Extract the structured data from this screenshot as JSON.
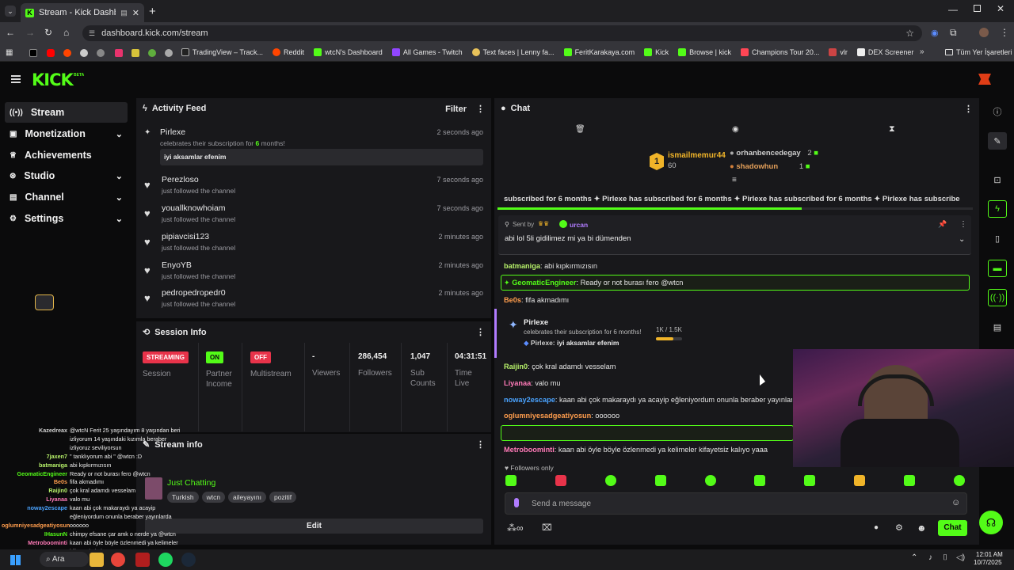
{
  "browser": {
    "tab_title": "Stream - Kick Dashboard",
    "url": "dashboard.kick.com/stream",
    "bookmarks": [
      "TradingView – Track...",
      "Reddit",
      "wtcN's Dashboard",
      "All Games - Twitch",
      "Text faces | Lenny fa...",
      "FeritKarakaya.com",
      "Kick",
      "Browse | kick",
      "Champions Tour 20...",
      "vlr",
      "DEX Screener"
    ],
    "all_bookmarks": "Tüm Yer İşaretleri"
  },
  "app": {
    "logo": "KICK",
    "beta": "BETA"
  },
  "sidebar": {
    "items": [
      {
        "label": "Stream"
      },
      {
        "label": "Monetization"
      },
      {
        "label": "Achievements"
      },
      {
        "label": "Studio"
      },
      {
        "label": "Channel"
      },
      {
        "label": "Settings"
      }
    ]
  },
  "activity": {
    "title": "Activity Feed",
    "filter": "Filter",
    "sub_event": {
      "name": "Pirlexe",
      "text_pre": "celebrates their subscription for ",
      "months": "6",
      "text_post": " months!",
      "time": "2 seconds ago",
      "message": "iyi aksamlar efenim"
    },
    "follows": [
      {
        "name": "Perezloso",
        "text": "just followed the channel",
        "time": "7 seconds ago"
      },
      {
        "name": "youallknowhoiam",
        "text": "just followed the channel",
        "time": "7 seconds ago"
      },
      {
        "name": "pipiavcisi123",
        "text": "just followed the channel",
        "time": "2 minutes ago"
      },
      {
        "name": "EnyoYB",
        "text": "just followed the channel",
        "time": "2 minutes ago"
      },
      {
        "name": "pedropedropedr0",
        "text": "just followed the channel",
        "time": "2 minutes ago"
      }
    ]
  },
  "session": {
    "title": "Session Info",
    "streaming": "STREAMING",
    "session_label": "Session",
    "partner_on": "ON",
    "partner_label": "Partner Income",
    "multistream_off": "OFF",
    "multistream_label": "Multistream",
    "viewers": "-",
    "viewers_label": "Viewers",
    "followers": "286,454",
    "followers_label": "Followers",
    "subs": "1,047",
    "subs_label": "Sub Counts",
    "time": "04:31:51",
    "time_label": "Time Live"
  },
  "stream_info": {
    "title": "Stream info",
    "category": "Just Chatting",
    "tags": [
      "Turkish",
      "wtcn",
      "aileyayını",
      "pozitif"
    ],
    "edit": "Edit"
  },
  "chat": {
    "title": "Chat",
    "leaderboard": [
      {
        "rank": "1",
        "name": "ismailmemur44",
        "count": "60"
      },
      {
        "name": "orhanbencedegay",
        "count": "2"
      },
      {
        "name": "shadowhun",
        "count": "1"
      }
    ],
    "ticker": "subscribed for 6 months  ✦ Pirlexe has subscribed for 6 months  ✦ Pirlexe has subscribed for 6 months  ✦ Pirlexe has subscribe",
    "pinned": {
      "sent_by": "Sent by",
      "user": "urcan",
      "text": "abi lol 5li gidilimez mi ya bi dümenden"
    },
    "messages": [
      {
        "user": "batmaniga",
        "text": "abi kıpkırmızısın",
        "color": "#b7f26a"
      },
      {
        "user": "GeomaticEngineer",
        "text": "Ready or not burası fero @wtcn",
        "color": "#53fc18"
      },
      {
        "user": "Be0s",
        "text": "fifa akmadımı",
        "color": "#ff9d4d"
      }
    ],
    "sub_card": {
      "name": "Pirlexe",
      "text": "celebrates their subscription for 6 months!",
      "progress": "1K / 1.5K",
      "msg_user": "Pirlexe:",
      "msg": "iyi aksamlar efenim"
    },
    "messages2": [
      {
        "user": "Raijin0",
        "text": "çok kral adamdı vesselam",
        "color": "#b7f26a"
      },
      {
        "user": "Liyanaa",
        "text": "valo mu",
        "color": "#ff7ab8"
      },
      {
        "user": "noway2escape",
        "text": "kaan abi çok makaraydı ya acayip eğleniyordum onunla beraber yayınlar",
        "color": "#4aa3ff"
      },
      {
        "user": "oglumniyesadgeatiyosun",
        "text": "oooooo",
        "color": "#ff9d4d"
      },
      {
        "user": "IHasunN",
        "text": "chimpy efsane çar amk o nerde ya @wtcn",
        "color": "#53fc18"
      },
      {
        "user": "Metroboominti",
        "text": "kaan abi öyle böyle özlenmedi ya kelimeler kifayetsiz kalıyo yaaa",
        "color": "#ff7ab8"
      }
    ],
    "followers_only": "Followers only",
    "placeholder": "Send a message",
    "send": "Chat"
  },
  "overlay_chat": [
    {
      "user": "Kazedreax",
      "text": "@wtcN Ferit 25 yaşındayım 8 yaşından beri",
      "color": "#cfcfcf"
    },
    {
      "user": "",
      "text": "izliyorum 14 yaşındaki kızımla beraber",
      "color": "#cfcfcf"
    },
    {
      "user": "",
      "text": "izliyoruz seviliyorsun",
      "color": "#cfcfcf"
    },
    {
      "user": "7jaxen7",
      "text": "\" tanklıyorum abi \" @wtcn :D",
      "color": "#b7f26a"
    },
    {
      "user": "batmaniga",
      "text": "abi kıpkırmızısın",
      "color": "#b7f26a"
    },
    {
      "user": "GeomaticEngineer",
      "text": "Ready or not burası fero @wtcn",
      "color": "#53fc18"
    },
    {
      "user": "Be0s",
      "text": "fifa akmadımı",
      "color": "#ff9d4d"
    },
    {
      "user": "Raijin0",
      "text": "çok kral adamdı vesselam",
      "color": "#b7f26a"
    },
    {
      "user": "Liyanaa",
      "text": "valo mu",
      "color": "#ff7ab8"
    },
    {
      "user": "noway2escape",
      "text": "kaan abi çok makaraydı ya acayip",
      "color": "#4aa3ff"
    },
    {
      "user": "",
      "text": "eğleniyordum onunla beraber yayınlarda",
      "color": "#4aa3ff"
    },
    {
      "user": "oglumniyesadgeatiyosun",
      "text": "oooooo",
      "color": "#ff9d4d"
    },
    {
      "user": "IHasunN",
      "text": "chimpy efsane çar amk o nerde ya @wtcn",
      "color": "#53fc18"
    },
    {
      "user": "Metroboominti",
      "text": "kaan abi öyle böyle özlenmedi ya kelimeler",
      "color": "#ff7ab8"
    },
    {
      "user": "",
      "text": "kifayetsiz kalıyo yaaa",
      "color": "#ff7ab8"
    }
  ],
  "taskbar": {
    "search": "Ara",
    "time": "12:01 AM",
    "date": "10/7/2025"
  }
}
